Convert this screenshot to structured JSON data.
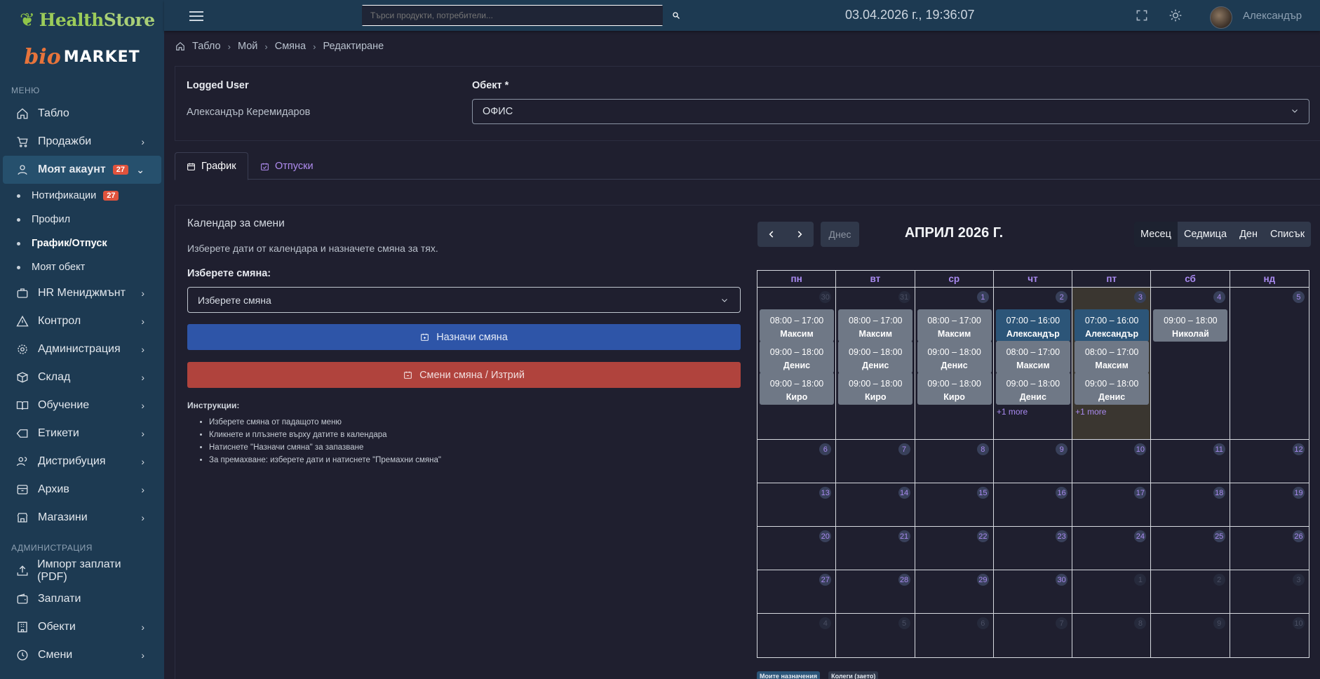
{
  "brand": {
    "name_a": "Health",
    "name_b": "Store",
    "bio": "bio",
    "market": "MARKET"
  },
  "sidebar": {
    "section_menu": "МЕНЮ",
    "section_admin": "АДМИНИСТРАЦИЯ",
    "items": [
      {
        "label": "Табло"
      },
      {
        "label": "Продажби"
      },
      {
        "label": "Моят акаунт",
        "badge": "27"
      },
      {
        "label": "HR Мениджмънт"
      },
      {
        "label": "Контрол"
      },
      {
        "label": "Администрация"
      },
      {
        "label": "Склад"
      },
      {
        "label": "Обучение"
      },
      {
        "label": "Етикети"
      },
      {
        "label": "Дистрибуция"
      },
      {
        "label": "Архив"
      },
      {
        "label": "Магазини"
      }
    ],
    "sub_items": [
      {
        "label": "Нотификации",
        "badge": "27"
      },
      {
        "label": "Профил"
      },
      {
        "label": "График/Отпуск"
      },
      {
        "label": "Моят обект"
      }
    ],
    "admin_items": [
      {
        "label": "Импорт заплати (PDF)"
      },
      {
        "label": "Заплати"
      },
      {
        "label": "Обекти"
      },
      {
        "label": "Смени"
      }
    ]
  },
  "topbar": {
    "search_placeholder": "Търси продукти, потребители...",
    "clock": "03.04.2026 г., 19:36:07",
    "username": "Александър"
  },
  "breadcrumb": [
    "Табло",
    "Мой",
    "Смяна",
    "Редактиране"
  ],
  "header_card": {
    "user_label": "Logged User",
    "user_value": "Александър Керемидаров",
    "object_label": "Обект *",
    "object_value": "ОФИС"
  },
  "tabs": [
    {
      "label": "График"
    },
    {
      "label": "Отпуски"
    }
  ],
  "left_panel": {
    "title": "Календар за смени",
    "description": "Изберете дати от календара и назначете смяна за тях.",
    "shift_label": "Изберете смяна:",
    "shift_select": "Изберете смяна",
    "assign_button": "Назначи смяна",
    "change_button": "Смени смяна / Изтрий",
    "instructions_title": "Инструкции:",
    "instructions": [
      "Изберете смяна от падащото меню",
      "Кликнете и плъзнете върху датите в календара",
      "Натиснете \"Назначи смяна\" за запазване",
      "За премахване: изберете дати и натиснете \"Премахни смяна\""
    ]
  },
  "calendar": {
    "today_button": "Днес",
    "month_title": "АПРИЛ 2026 Г.",
    "views": [
      "Месец",
      "Седмица",
      "Ден",
      "Списък"
    ],
    "weekdays": [
      "пн",
      "вт",
      "ср",
      "чт",
      "пт",
      "сб",
      "нд"
    ],
    "weeks": [
      [
        {
          "num": "30",
          "other": true,
          "events": [
            {
              "time": "08:00 – 17:00",
              "name": "Максим"
            },
            {
              "time": "09:00 – 18:00",
              "name": "Денис"
            },
            {
              "time": "09:00 – 18:00",
              "name": "Киро"
            }
          ]
        },
        {
          "num": "31",
          "other": true,
          "events": [
            {
              "time": "08:00 – 17:00",
              "name": "Максим"
            },
            {
              "time": "09:00 – 18:00",
              "name": "Денис"
            },
            {
              "time": "09:00 – 18:00",
              "name": "Киро"
            }
          ]
        },
        {
          "num": "1",
          "events": [
            {
              "time": "08:00 – 17:00",
              "name": "Максим"
            },
            {
              "time": "09:00 – 18:00",
              "name": "Денис"
            },
            {
              "time": "09:00 – 18:00",
              "name": "Киро"
            }
          ]
        },
        {
          "num": "2",
          "events": [
            {
              "time": "07:00 – 16:00",
              "name": "Александър",
              "mine": true
            },
            {
              "time": "08:00 – 17:00",
              "name": "Максим"
            },
            {
              "time": "09:00 – 18:00",
              "name": "Денис"
            }
          ],
          "more": "+1 more"
        },
        {
          "num": "3",
          "today": true,
          "events": [
            {
              "time": "07:00 – 16:00",
              "name": "Александър",
              "mine": true
            },
            {
              "time": "08:00 – 17:00",
              "name": "Максим"
            },
            {
              "time": "09:00 – 18:00",
              "name": "Денис"
            }
          ],
          "more": "+1 more"
        },
        {
          "num": "4",
          "events": [
            {
              "time": "09:00 – 18:00",
              "name": "Николай"
            }
          ]
        },
        {
          "num": "5",
          "events": []
        }
      ],
      [
        {
          "num": "6"
        },
        {
          "num": "7"
        },
        {
          "num": "8"
        },
        {
          "num": "9"
        },
        {
          "num": "10"
        },
        {
          "num": "11"
        },
        {
          "num": "12"
        }
      ],
      [
        {
          "num": "13"
        },
        {
          "num": "14"
        },
        {
          "num": "15"
        },
        {
          "num": "16"
        },
        {
          "num": "17"
        },
        {
          "num": "18"
        },
        {
          "num": "19"
        }
      ],
      [
        {
          "num": "20"
        },
        {
          "num": "21"
        },
        {
          "num": "22"
        },
        {
          "num": "23"
        },
        {
          "num": "24"
        },
        {
          "num": "25"
        },
        {
          "num": "26"
        }
      ],
      [
        {
          "num": "27"
        },
        {
          "num": "28"
        },
        {
          "num": "29"
        },
        {
          "num": "30"
        },
        {
          "num": "1",
          "other": true
        },
        {
          "num": "2",
          "other": true
        },
        {
          "num": "3",
          "other": true
        }
      ],
      [
        {
          "num": "4",
          "other": true
        },
        {
          "num": "5",
          "other": true
        },
        {
          "num": "6",
          "other": true
        },
        {
          "num": "7",
          "other": true
        },
        {
          "num": "8",
          "other": true
        },
        {
          "num": "9",
          "other": true
        },
        {
          "num": "10",
          "other": true
        }
      ]
    ],
    "legend": [
      "Моите назначения",
      "Колеги (заето)"
    ]
  },
  "colors": {
    "sidebar_bg": "#1d3a52",
    "page_bg": "#1f1f2f",
    "accent_purple": "#a98af0",
    "assign_blue": "#2e55a8",
    "delete_red": "#b0433d",
    "event_gray": "#6f7886",
    "event_mine": "#2c5578"
  }
}
